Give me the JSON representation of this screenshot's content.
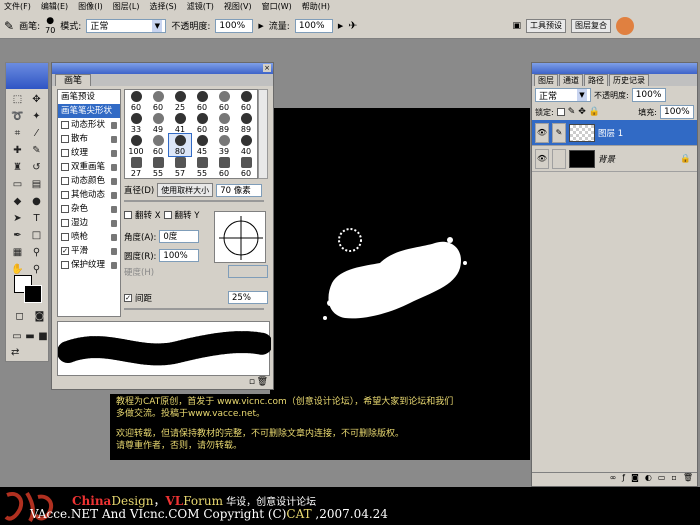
{
  "menu": [
    "文件(F)",
    "编辑(E)",
    "图像(I)",
    "图层(L)",
    "选择(S)",
    "滤镜(T)",
    "视图(V)",
    "窗口(W)",
    "帮助(H)"
  ],
  "options": {
    "brush_label": "画笔:",
    "brush_size": "70",
    "mode_label": "模式:",
    "mode_value": "正常",
    "opacity_label": "不透明度:",
    "opacity_value": "100%",
    "flow_label": "流量:",
    "flow_value": "100%",
    "btn1": "工具预设",
    "btn2": "图层复合"
  },
  "brush_panel": {
    "tab": "画笔",
    "items": [
      {
        "label": "画笔预设",
        "check": "none",
        "active": false
      },
      {
        "label": "画笔笔尖形状",
        "check": "none",
        "active": true
      },
      {
        "label": "动态形状",
        "check": "off",
        "active": false
      },
      {
        "label": "散布",
        "check": "off",
        "active": false
      },
      {
        "label": "纹理",
        "check": "off",
        "active": false
      },
      {
        "label": "双重画笔",
        "check": "off",
        "active": false
      },
      {
        "label": "动态颜色",
        "check": "off",
        "active": false
      },
      {
        "label": "其他动态",
        "check": "off",
        "active": false
      },
      {
        "label": "杂色",
        "check": "off",
        "active": false
      },
      {
        "label": "湿边",
        "check": "off",
        "active": false
      },
      {
        "label": "喷枪",
        "check": "off",
        "active": false
      },
      {
        "label": "平滑",
        "check": "on",
        "active": false
      },
      {
        "label": "保护纹理",
        "check": "off",
        "active": false
      }
    ],
    "presets": [
      "60",
      "60",
      "25",
      "60",
      "60",
      "60",
      "33",
      "49",
      "41",
      "60",
      "89",
      "89",
      "100",
      "60",
      "80",
      "45",
      "39",
      "40",
      "27",
      "55",
      "57",
      "55",
      "60",
      "60"
    ],
    "diameter_label": "直径(D)",
    "use_sample": "使用取样大小",
    "diameter_value": "70 像素",
    "flip_x": "翻转 X",
    "flip_y": "翻转 Y",
    "angle_label": "角度(A):",
    "angle_value": "0度",
    "round_label": "圆度(R):",
    "round_value": "100%",
    "hardness_label": "硬度(H)",
    "spacing_label": "间距",
    "spacing_value": "25%"
  },
  "layers_panel": {
    "tabs": [
      "图层",
      "通道",
      "路径",
      "历史记录"
    ],
    "mode": "正常",
    "opacity_label": "不透明度:",
    "opacity_value": "100%",
    "lock_label": "锁定:",
    "fill_label": "填充:",
    "fill_value": "100%",
    "layers": [
      {
        "name": "图层 1",
        "active": true
      },
      {
        "name": "背景",
        "active": false
      }
    ]
  },
  "note": {
    "line1": "教程为CAT原创，首发于 www.vicnc.com（创意设计论坛），希望大家到论坛和我们",
    "line2": "多做交流。投稿于www.vacce.net。",
    "line3": "欢迎转载，但请保持教材的完整，不可删除文章内连接，不可删除版权。",
    "line4": "请尊重作者，否则，请勿转载。"
  },
  "footer": {
    "china": "China",
    "design": "Design",
    "sep": "，",
    "vl": "VL",
    "forum": "Forum",
    "tail1": " 华设，创意设计论坛",
    "line2a": "VAcce.NET  And  VIcnc.COM  Copyright (C)",
    "cat": "CAT",
    "line2b": " ,2007.04.24"
  }
}
